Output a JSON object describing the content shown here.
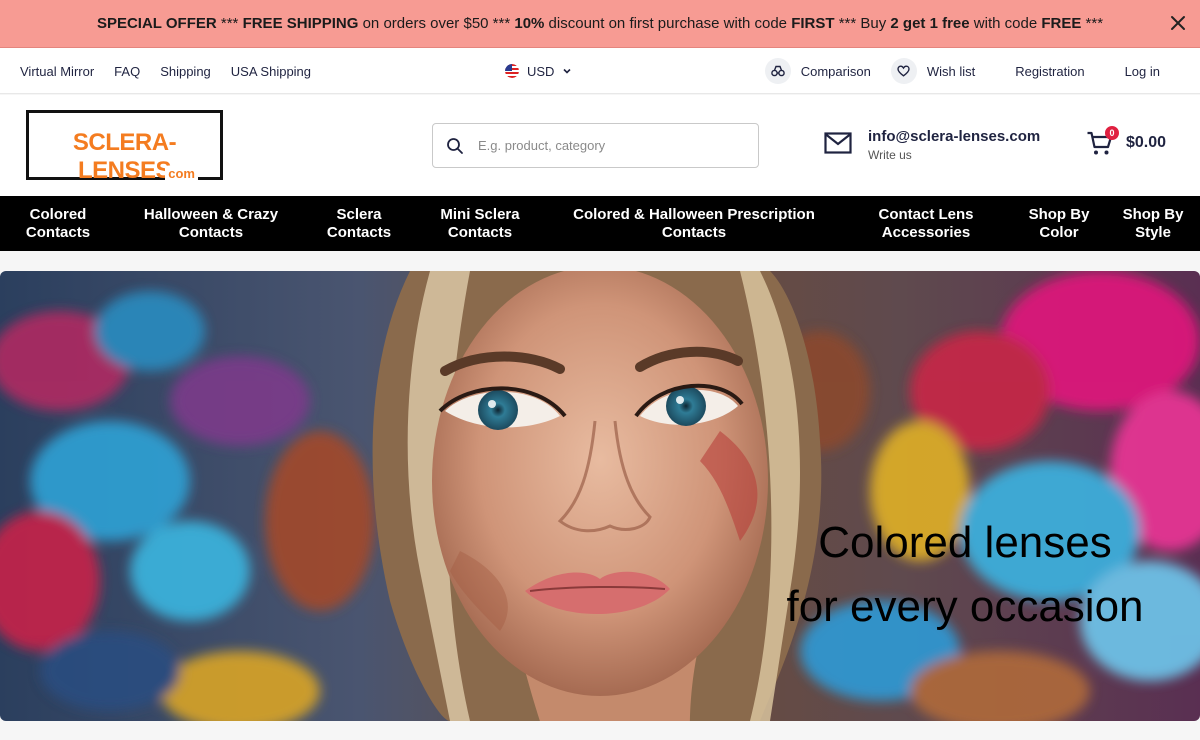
{
  "promo": {
    "p1": "SPECIAL OFFER",
    "p2": " *** ",
    "p3": "FREE SHIPPING",
    "p4": " on orders over $50 *** ",
    "p5": "10%",
    "p6": " discount on first purchase with code ",
    "p7": "FIRST",
    "p8": " *** Buy ",
    "p9": "2 get 1 free",
    "p10": " with code ",
    "p11": "FREE",
    "p12": " ***"
  },
  "utility": {
    "links": [
      "Virtual Mirror",
      "FAQ",
      "Shipping",
      "USA Shipping"
    ],
    "currency": "USD",
    "comparison": "Comparison",
    "wishlist": "Wish list",
    "registration": "Registration",
    "login": "Log in"
  },
  "header": {
    "logo_main": "SCLERA-LENSES",
    "logo_com": "com",
    "search_placeholder": "E.g. product, category",
    "email": "info@sclera-lenses.com",
    "write_us": "Write us",
    "cart_count": "0",
    "cart_total": "$0.00"
  },
  "nav": [
    {
      "l1": "Colored",
      "l2": "Contacts"
    },
    {
      "l1": "Halloween & Crazy",
      "l2": "Contacts"
    },
    {
      "l1": "Sclera",
      "l2": "Contacts"
    },
    {
      "l1": "Mini Sclera",
      "l2": "Contacts"
    },
    {
      "l1": "Colored & Halloween Prescription",
      "l2": "Contacts"
    },
    {
      "l1": "Contact Lens",
      "l2": "Accessories"
    },
    {
      "l1": "Shop By",
      "l2": "Color"
    },
    {
      "l1": "Shop By",
      "l2": "Style"
    }
  ],
  "hero": {
    "line1": "Colored lenses",
    "line2": "for every occasion"
  },
  "colors": {
    "promo_bg": "#f79b93",
    "logo_orange": "#f47c20",
    "nav_bg": "#000000",
    "badge": "#e02040"
  }
}
